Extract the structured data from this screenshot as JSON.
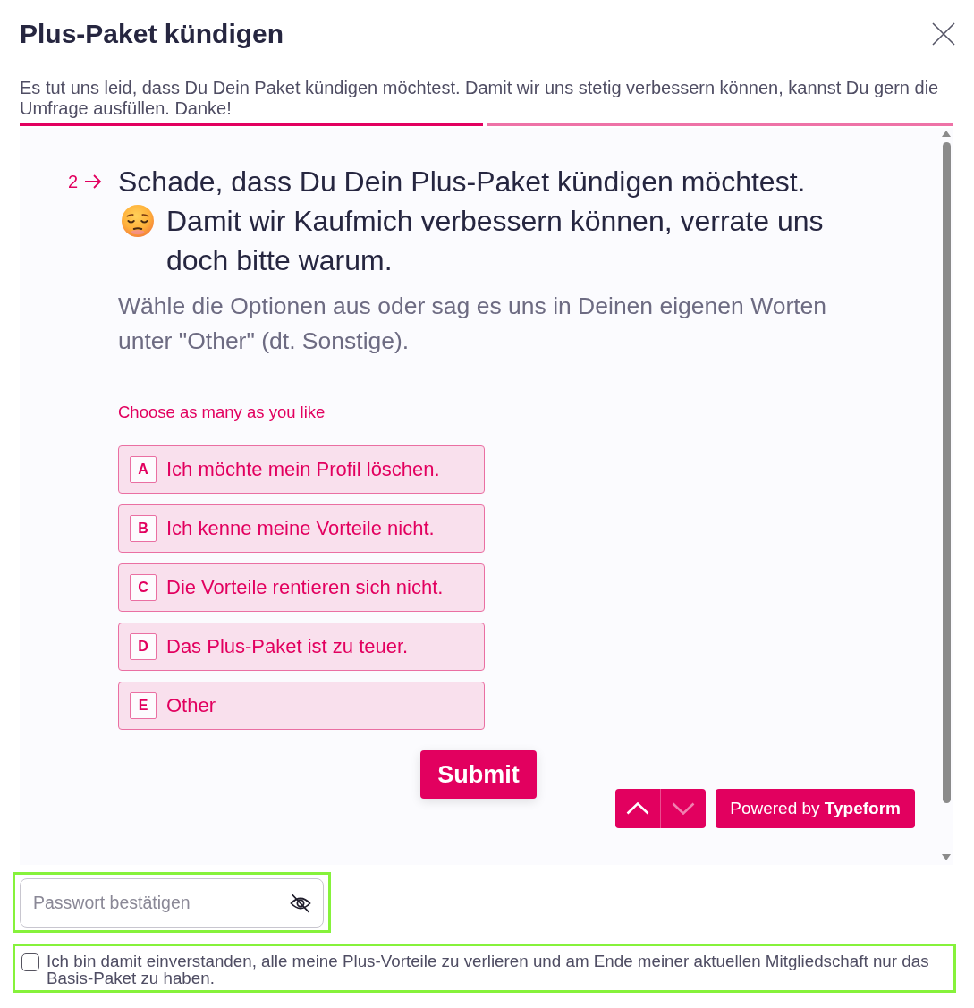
{
  "dialog": {
    "title": "Plus-Paket kündigen",
    "intro": "Es tut uns leid, dass Du Dein Paket kündigen möchtest. Damit wir uns stetig verbessern können, kannst Du gern die Umfrage ausfüllen. Danke!"
  },
  "progress": {
    "level": 0.5
  },
  "survey": {
    "question_number": "2",
    "question_text": "Schade, dass Du Dein Plus-Paket kündigen möchtest.",
    "question_text_2": "Damit wir Kaufmich verbessern können, verrate uns doch bitte warum.",
    "description": "Wähle die Optionen aus oder sag es uns in Deinen eigenen Worten unter \"Other\" (dt. Sonstige).",
    "hint": "Choose as many as you like",
    "options": [
      {
        "key": "A",
        "label": "Ich möchte mein Profil löschen.",
        "selected": false
      },
      {
        "key": "B",
        "label": "Ich kenne meine Vorteile nicht.",
        "selected": false
      },
      {
        "key": "C",
        "label": "Die Vorteile rentieren sich nicht.",
        "selected": false
      },
      {
        "key": "D",
        "label": "Das Plus-Paket ist zu teuer.",
        "selected": false
      },
      {
        "key": "E",
        "label": "Other",
        "selected": false
      }
    ],
    "submit": "Submit",
    "navigation": [
      {
        "kind": "previous",
        "disabled": false
      },
      {
        "kind": "next",
        "disabled": true
      }
    ],
    "branding": "Powered by **Typeform**"
  },
  "password": {
    "placeholder": "Passwort bestätigen",
    "highlighted": true
  },
  "consent": {
    "checked": false,
    "label": "Ich bin damit einverstanden, alle meine Plus-Vorteile zu verlieren und am Ende meiner aktuellen Mitgliedschaft nur das Basis-Paket zu haben.",
    "highlighted": true
  }
}
